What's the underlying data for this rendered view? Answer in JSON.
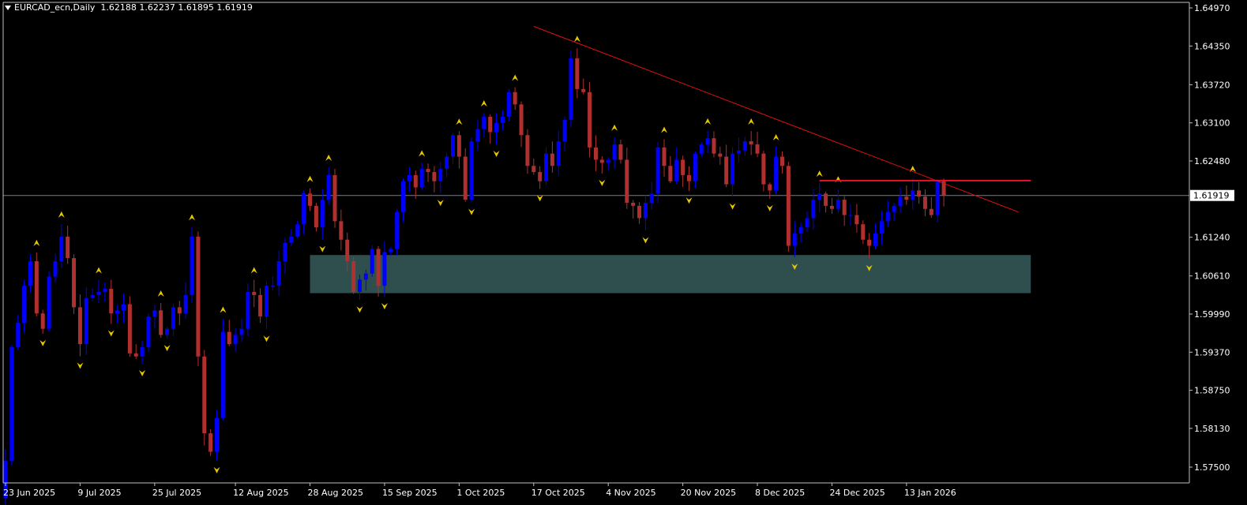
{
  "header": {
    "symbol": "EURCAD_ecn,Daily",
    "ohlc": "1.62188 1.62237 1.61895 1.61919"
  },
  "colors": {
    "background": "#000000",
    "axis": "#c0c0c0",
    "text": "#ffffff",
    "bull": "#0000ff",
    "bear": "#b03030",
    "fractal": "#e8c800",
    "trendline": "#e01010",
    "resistance": "#e8102a",
    "zone": "#2f4f4f",
    "bid_line": "#708090"
  },
  "chart_data": {
    "type": "candlestick",
    "symbol": "EURCAD_ecn",
    "timeframe": "Daily",
    "y_ticks": [
      "1.64970",
      "1.64350",
      "1.63720",
      "1.63100",
      "1.62480",
      "1.61240",
      "1.60610",
      "1.59990",
      "1.59370",
      "1.58750",
      "1.58130",
      "1.57500"
    ],
    "ylim": [
      1.575,
      1.6497
    ],
    "current_price": "1.61919",
    "x_ticks": [
      "23 Jun 2025",
      "9 Jul 2025",
      "25 Jul 2025",
      "12 Aug 2025",
      "28 Aug 2025",
      "15 Sep 2025",
      "1 Oct 2025",
      "17 Oct 2025",
      "4 Nov 2025",
      "20 Nov 2025",
      "8 Dec 2025",
      "24 Dec 2025",
      "13 Jan 2026"
    ],
    "x_tick_bars": [
      0,
      12,
      24,
      37,
      49,
      61,
      73,
      85,
      97,
      109,
      121,
      133,
      145
    ],
    "bar_count": 152,
    "closes": [
      1.576,
      1.5945,
      1.5985,
      1.6045,
      1.6085,
      1.6,
      1.5975,
      1.606,
      1.6085,
      1.6125,
      1.609,
      1.601,
      1.595,
      1.6025,
      1.603,
      1.6035,
      1.604,
      1.6,
      1.6005,
      1.6015,
      1.5935,
      1.593,
      1.5945,
      1.5995,
      1.6005,
      1.5965,
      1.5975,
      1.601,
      1.6,
      1.603,
      1.6125,
      1.593,
      1.5805,
      1.5775,
      1.583,
      1.597,
      1.595,
      1.5965,
      1.5975,
      1.6035,
      1.603,
      1.5995,
      1.6045,
      1.6045,
      1.6085,
      1.6115,
      1.6125,
      1.6145,
      1.6195,
      1.6175,
      1.614,
      1.6185,
      1.6225,
      1.615,
      1.612,
      1.6085,
      1.6035,
      1.6055,
      1.6065,
      1.6105,
      1.6045,
      1.61,
      1.6105,
      1.6165,
      1.6215,
      1.6225,
      1.6205,
      1.6235,
      1.623,
      1.6215,
      1.6235,
      1.6255,
      1.629,
      1.6255,
      1.6185,
      1.628,
      1.63,
      1.632,
      1.6295,
      1.631,
      1.632,
      1.636,
      1.634,
      1.629,
      1.624,
      1.623,
      1.6215,
      1.626,
      1.624,
      1.628,
      1.6315,
      1.6415,
      1.6365,
      1.636,
      1.627,
      1.625,
      1.6245,
      1.625,
      1.6275,
      1.625,
      1.618,
      1.6175,
      1.6155,
      1.618,
      1.6195,
      1.627,
      1.624,
      1.6215,
      1.625,
      1.6225,
      1.6215,
      1.626,
      1.6275,
      1.6285,
      1.626,
      1.6255,
      1.621,
      1.626,
      1.6265,
      1.628,
      1.6275,
      1.626,
      1.621,
      1.62,
      1.6255,
      1.624,
      1.611,
      1.613,
      1.614,
      1.6155,
      1.6185,
      1.6195,
      1.6175,
      1.617,
      1.6185,
      1.616,
      1.616,
      1.6145,
      1.612,
      1.611,
      1.613,
      1.615,
      1.6165,
      1.6175,
      1.619,
      1.6185,
      1.62,
      1.619,
      1.617,
      1.616,
      1.6215,
      1.6192
    ],
    "trendline": {
      "from_bar": 85,
      "from_price": 1.6467,
      "to_bar": 163,
      "to_price": 1.6165
    },
    "resistance": {
      "from_bar": 131,
      "to_bar": 165,
      "price": 1.6216
    },
    "zone": {
      "from_bar": 49,
      "to_bar": 165,
      "top_price": 1.6095,
      "bottom_price": 1.6033
    }
  }
}
